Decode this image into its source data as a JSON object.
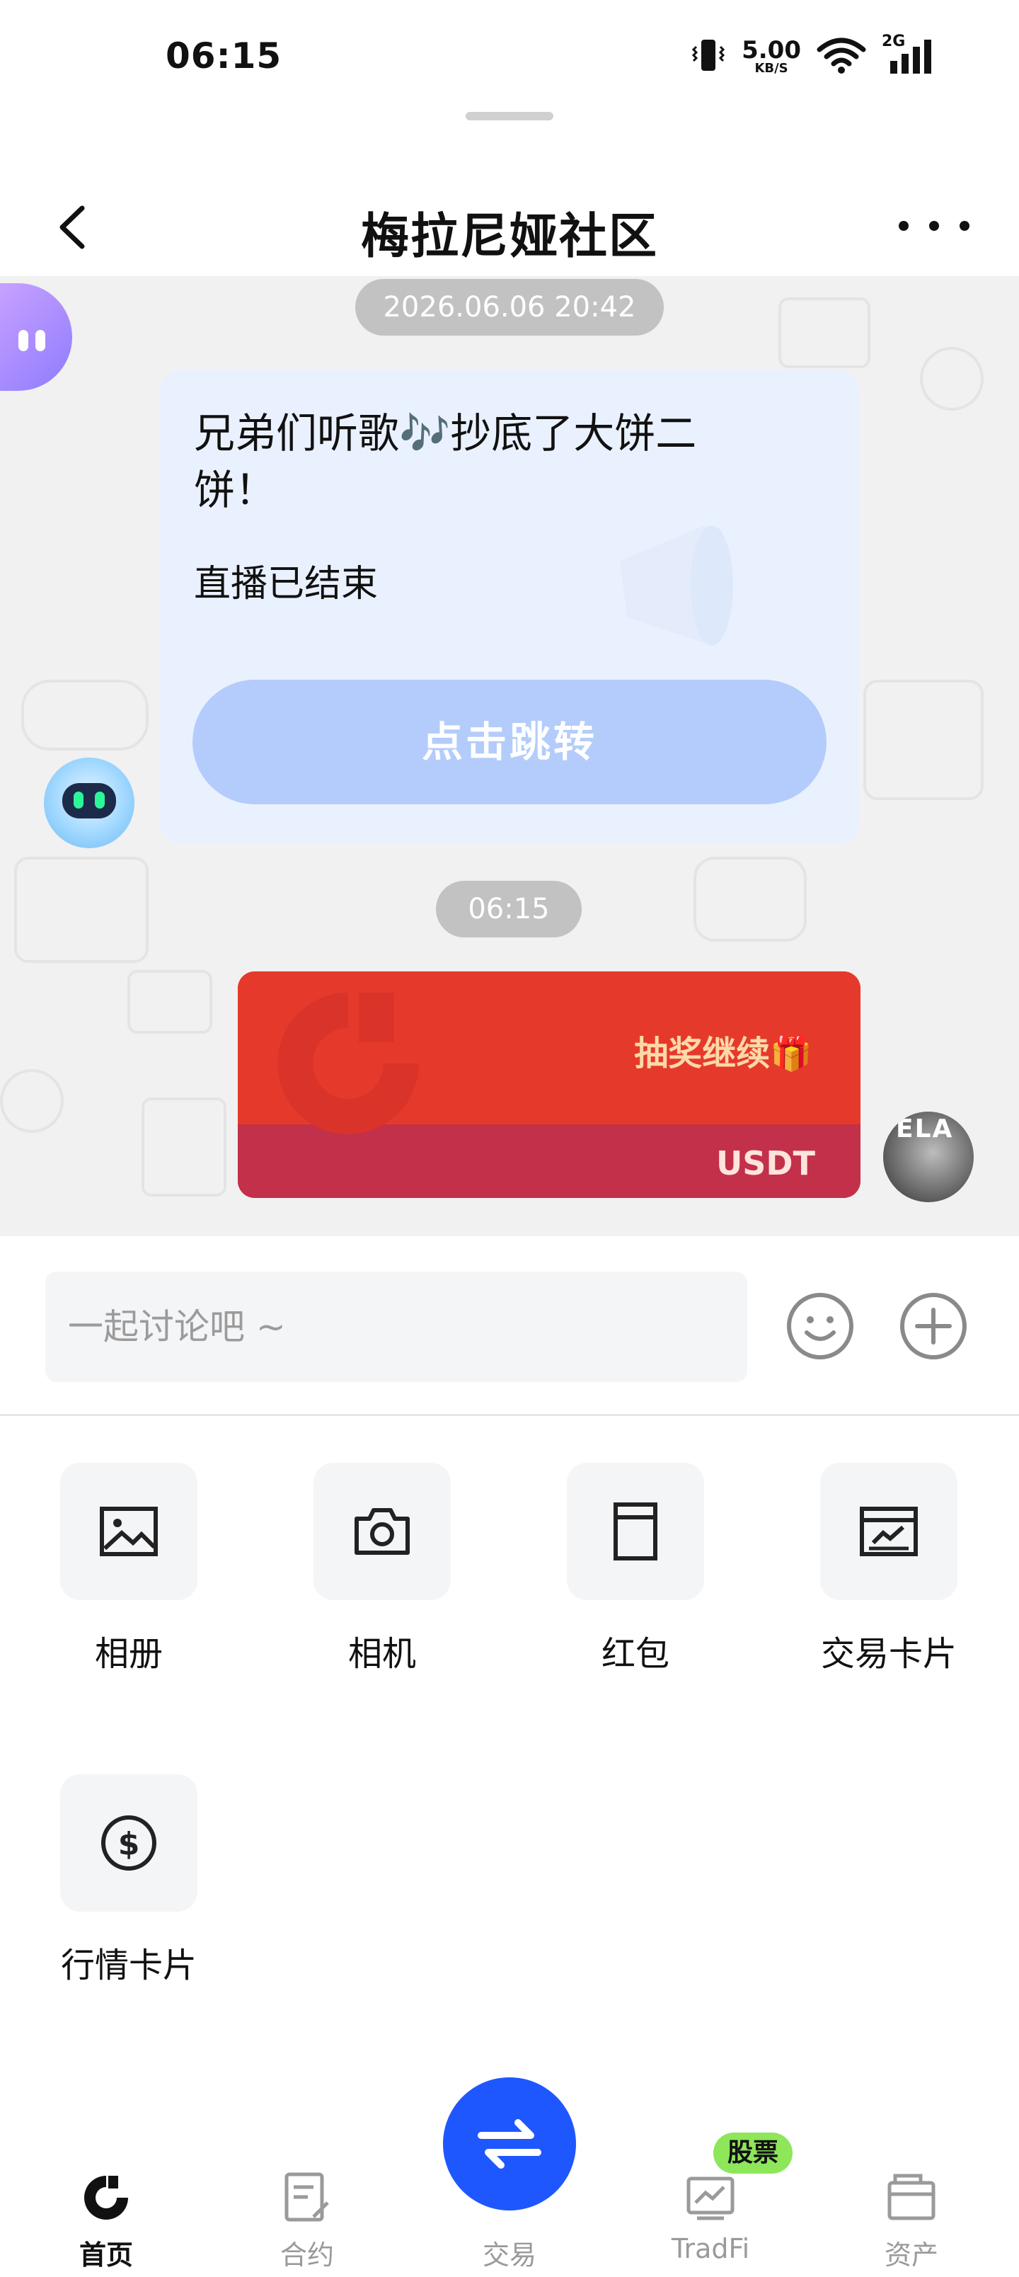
{
  "status_bar": {
    "time": "06:15",
    "net_speed_value": "5.00",
    "net_speed_unit": "KB/S",
    "signal_label": "2G"
  },
  "header": {
    "title": "梅拉尼娅社区"
  },
  "chat": {
    "messages": [
      {
        "timestamp": "2026.06.06 20:42",
        "type": "live-card",
        "title": "兄弟们听歌🎶抄底了大饼二饼！",
        "status": "直播已结束",
        "button_label": "点击跳转"
      },
      {
        "timestamp": "06:15",
        "type": "red-packet",
        "text": "抽奖继续🎁",
        "coin": "USDT",
        "avatar_text": "ELA"
      }
    ]
  },
  "input": {
    "placeholder": "一起讨论吧 ~"
  },
  "tools": [
    {
      "label": "相册",
      "icon": "image-icon"
    },
    {
      "label": "相机",
      "icon": "camera-icon"
    },
    {
      "label": "红包",
      "icon": "red-packet-icon"
    },
    {
      "label": "交易卡片",
      "icon": "trade-card-icon"
    },
    {
      "label": "行情卡片",
      "icon": "market-card-icon"
    }
  ],
  "bottom_nav": {
    "items": [
      {
        "label": "首页",
        "icon": "home-icon",
        "active": true
      },
      {
        "label": "合约",
        "icon": "contract-icon",
        "active": false
      },
      {
        "label": "交易",
        "icon": "swap-icon",
        "active": false
      },
      {
        "label": "TradFi",
        "icon": "tradfi-icon",
        "active": false
      },
      {
        "label": "资产",
        "icon": "wallet-icon",
        "active": false
      }
    ],
    "tradfi_badge": "股票"
  },
  "colors": {
    "accent_blue": "#1f57ff",
    "live_card_bg": "#eaf1fe",
    "live_button": "#b3ccfb",
    "red_packet_top": "#e53a2b",
    "red_packet_bottom": "#c2304a",
    "badge_green": "#8ee65a"
  }
}
